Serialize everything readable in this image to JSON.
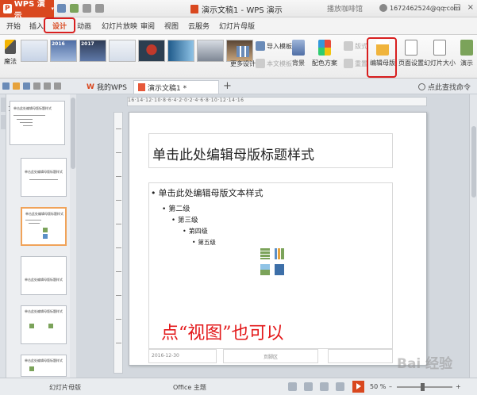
{
  "titlebar": {
    "app_name": "WPS 演示",
    "app_logo": "P",
    "doc_title": "演示文稿1 - WPS 演示",
    "brand_text": "播放咖啡馆",
    "user_email": "1672462524@qq.com"
  },
  "menu": {
    "items": [
      "开始",
      "插入",
      "设计",
      "动画",
      "幻灯片放映",
      "审阅",
      "视图",
      "云服务",
      "幻灯片母版"
    ],
    "active": "设计"
  },
  "ribbon": {
    "magic_label": "魔法",
    "template_numbers": [
      "",
      "2016",
      "2017",
      "",
      "",
      "",
      "",
      ""
    ],
    "more_design": "更多设计",
    "import_template": "导入模板",
    "local_template": "本文模板",
    "background": "背景",
    "color_scheme": "配色方案",
    "layout": "版式",
    "reset": "重置",
    "edit_master": "编辑母版",
    "page_setup": "页面设置",
    "slide_size": "幻灯片大小",
    "presenter": "演示"
  },
  "tabs": {
    "home": "我的WPS",
    "doc": "演示文稿1 *",
    "add": "+",
    "search": "点此查找命令"
  },
  "slide_panel": {
    "first_num": "1",
    "thumbs": [
      {
        "title": "单击此处编辑母版标题样式"
      },
      {
        "title": "单击此处编辑母版标题样式"
      },
      {
        "title": "单击此处编辑母版标题样式"
      },
      {
        "title": "单击此处编辑母版标题样式"
      },
      {
        "title": "单击此处编辑母版标题样式"
      },
      {
        "title": "单击此处编辑母版标题样式"
      }
    ]
  },
  "slide": {
    "ruler_text": "16·14·12·10·8·6·4·2·0·2·4·6·8·10·12·14·16",
    "title": "单击此处编辑母版标题样式",
    "body_levels": [
      "单击此处编辑母版文本样式",
      "第二级",
      "第三级",
      "第四级",
      "第五级"
    ],
    "footer_date": "2016-12-30",
    "footer_center": "页脚区",
    "annotation": "点“视图”也可以"
  },
  "statusbar": {
    "left_label": "幻灯片母版",
    "theme": "Office 主题",
    "zoom": "50 %"
  },
  "watermark": "Bai 经验",
  "colors": {
    "accent": "#d9481f",
    "highlight_box": "#d81e1e",
    "annotation": "#e3191b"
  }
}
